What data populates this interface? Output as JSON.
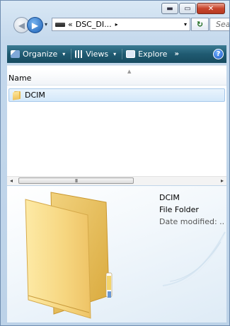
{
  "window": {
    "caption_buttons": {
      "minimize": "▬",
      "maximize": "▭",
      "close": "✕"
    }
  },
  "nav": {
    "back_icon": "back-arrow-icon",
    "forward_icon": "forward-arrow-icon",
    "recent_dropdown": "▾",
    "address": {
      "separator_left": "«",
      "path": "DSC_DI...",
      "separator_right": "▸",
      "dropdown": "▾"
    },
    "refresh": "↻",
    "search_placeholder": "Search"
  },
  "command_bar": {
    "organize": "Organize",
    "views": "Views",
    "explore": "Explore",
    "more": "»",
    "help": "?",
    "dropdown_glyph": "▾"
  },
  "file_list": {
    "column_header": "Name",
    "items": [
      {
        "name": "DCIM",
        "selected": true
      }
    ]
  },
  "scrollbar": {
    "left": "◂",
    "right": "▸",
    "grip": "III"
  },
  "preview": {
    "name": "DCIM",
    "type": "File Folder",
    "meta_label": "Date modified: .."
  },
  "colors": {
    "command_bar": "#1f5a71",
    "selection": "#d3e8fa",
    "folder": "#f3ce6a"
  }
}
